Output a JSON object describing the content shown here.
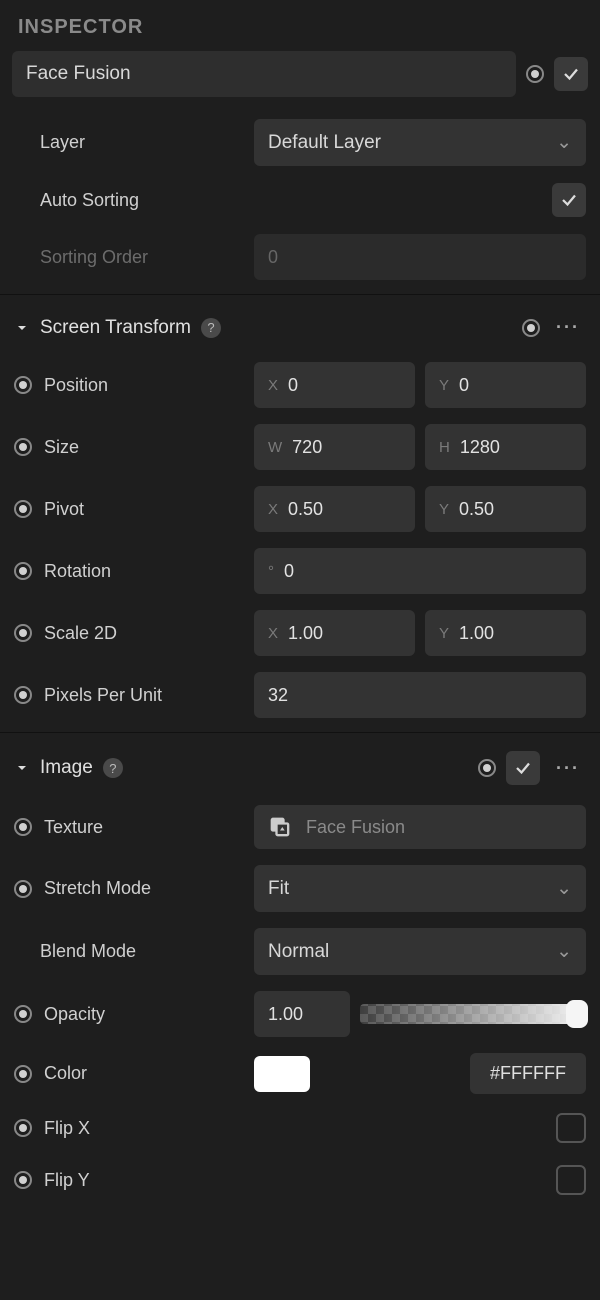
{
  "panel_title": "INSPECTOR",
  "object_name": "Face Fusion",
  "layer": {
    "label": "Layer",
    "value": "Default Layer"
  },
  "auto_sorting": {
    "label": "Auto Sorting",
    "value": true
  },
  "sorting_order": {
    "label": "Sorting Order",
    "value": "0"
  },
  "screen_transform": {
    "title": "Screen Transform",
    "position": {
      "label": "Position",
      "x": "0",
      "y": "0"
    },
    "size": {
      "label": "Size",
      "w": "720",
      "h": "1280"
    },
    "pivot": {
      "label": "Pivot",
      "x": "0.50",
      "y": "0.50"
    },
    "rotation": {
      "label": "Rotation",
      "value": "0"
    },
    "scale2d": {
      "label": "Scale 2D",
      "x": "1.00",
      "y": "1.00"
    },
    "ppu": {
      "label": "Pixels Per Unit",
      "value": "32"
    }
  },
  "image": {
    "title": "Image",
    "texture": {
      "label": "Texture",
      "value": "Face Fusion"
    },
    "stretch": {
      "label": "Stretch Mode",
      "value": "Fit"
    },
    "blend": {
      "label": "Blend Mode",
      "value": "Normal"
    },
    "opacity": {
      "label": "Opacity",
      "value": "1.00"
    },
    "color": {
      "label": "Color",
      "hex": "#FFFFFF"
    },
    "flipx": {
      "label": "Flip X",
      "value": false
    },
    "flipy": {
      "label": "Flip Y",
      "value": false
    }
  }
}
